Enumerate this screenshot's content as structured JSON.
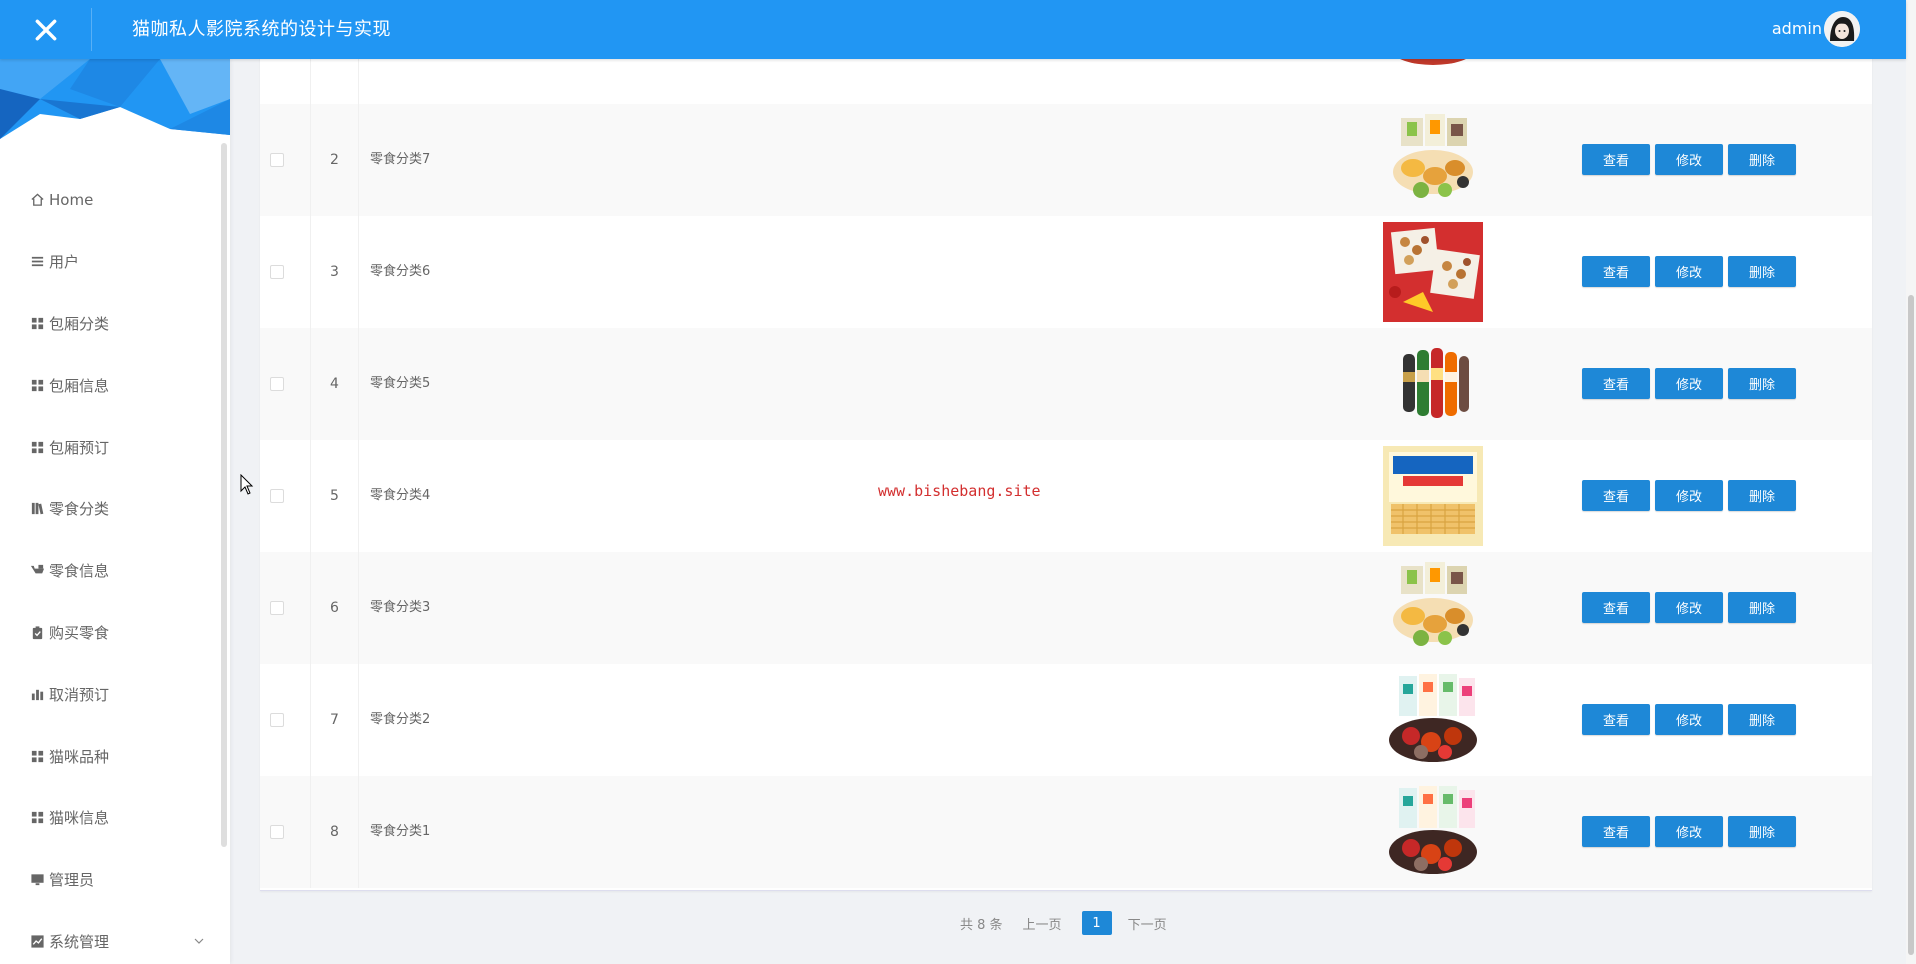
{
  "header": {
    "title": "猫咖私人影院系统的设计与实现",
    "user": "admin",
    "bg_color": "#2196f3"
  },
  "sidebar": {
    "items": [
      {
        "label": "Home",
        "icon": "home-icon"
      },
      {
        "label": "用户",
        "icon": "list-icon"
      },
      {
        "label": "包厢分类",
        "icon": "grid-icon"
      },
      {
        "label": "包厢信息",
        "icon": "grid-icon"
      },
      {
        "label": "包厢预订",
        "icon": "grid-icon"
      },
      {
        "label": "零食分类",
        "icon": "book-icon"
      },
      {
        "label": "零食信息",
        "icon": "cart-icon"
      },
      {
        "label": "购买零食",
        "icon": "clipboard-icon"
      },
      {
        "label": "取消预订",
        "icon": "bar-chart-icon"
      },
      {
        "label": "猫咪品种",
        "icon": "grid-icon"
      },
      {
        "label": "猫咪信息",
        "icon": "grid-icon"
      },
      {
        "label": "管理员",
        "icon": "monitor-icon"
      },
      {
        "label": "系统管理",
        "icon": "line-chart-icon",
        "expandable": true
      }
    ]
  },
  "table": {
    "rows": [
      {
        "index": "2",
        "name": "零食分类7",
        "image": "snack-gift-box"
      },
      {
        "index": "3",
        "name": "零食分类6",
        "image": "nut-box"
      },
      {
        "index": "4",
        "name": "零食分类5",
        "image": "chip-cans"
      },
      {
        "index": "5",
        "name": "零食分类4",
        "image": "waffle-pack"
      },
      {
        "index": "6",
        "name": "零食分类3",
        "image": "snack-gift-box"
      },
      {
        "index": "7",
        "name": "零食分类2",
        "image": "snack-bags-bowl"
      },
      {
        "index": "8",
        "name": "零食分类1",
        "image": "snack-bags-bowl"
      }
    ],
    "actions": {
      "view": "查看",
      "edit": "修改",
      "delete": "删除"
    }
  },
  "watermark": "www.bishebang.site",
  "pagination": {
    "total": "共 8 条",
    "prev": "上一页",
    "current": "1",
    "next": "下一页"
  },
  "colors": {
    "accent": "#2196f3",
    "button": "#1e88d7",
    "watermark": "#d32f2f"
  }
}
